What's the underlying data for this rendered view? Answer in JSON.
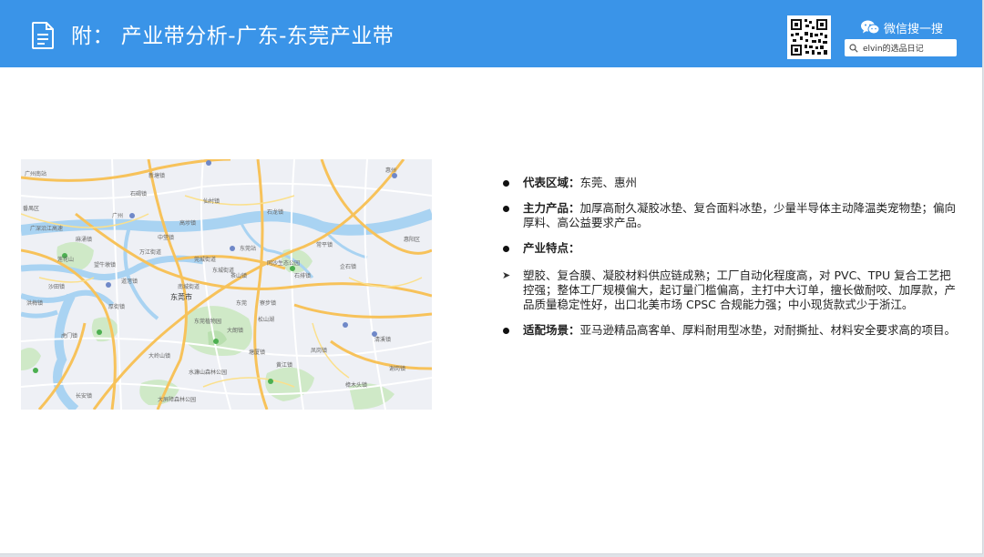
{
  "header": {
    "title": "附：  产业带分析-广东-东莞产业带",
    "wechat_label": "微信搜一搜",
    "search_text": "elvin的选品日记",
    "bg_color": "#3a94e8"
  },
  "map": {
    "center_label": "东莞市",
    "labels": [
      "广州",
      "广深沿江高速",
      "东莞",
      "东莞站",
      "惠州",
      "清溪镇",
      "樟木头镇",
      "石碣镇",
      "石龙镇",
      "茶山镇",
      "麻涌镇",
      "沙田镇",
      "厚街镇",
      "虎门镇",
      "长安镇",
      "大岭山镇",
      "寮步镇",
      "大朗镇",
      "黄江镇",
      "常平镇",
      "凤岗镇",
      "塘厦镇",
      "东莞植物园",
      "广州南站",
      "番禺区",
      "莲花山",
      "石排镇",
      "企石镇",
      "谢岗镇",
      "惠阳区",
      "新塘镇",
      "仙村镇",
      "中堂镇",
      "望牛墩镇",
      "道滘镇",
      "洪梅镇",
      "高埗镇",
      "东城街道",
      "南城街道",
      "万江街道",
      "莞城街道",
      "松山湖",
      "同沙生态公园",
      "水濂山森林公园",
      "大屏障森林公园"
    ]
  },
  "content": {
    "items": [
      {
        "label": "代表区域：",
        "text": "东莞、惠州"
      },
      {
        "label": "主力产品：",
        "text": "加厚高耐久凝胶冰垫、复合面料冰垫，少量半导体主动降温类宠物垫；偏向厚料、高公益要求产品。"
      },
      {
        "label": "产业特点：",
        "text": ""
      },
      {
        "label": "",
        "text": "塑胶、复合膜、凝胶材料供应链成熟；工厂自动化程度高，对 PVC、TPU 复合工艺把控强；整体工厂规模偏大，起订量门槛偏高，主打中大订单，擅长做耐咬、加厚款，产品质量稳定性好，出口北美市场 CPSC 合规能力强；中小现货款式少于浙江。"
      },
      {
        "label": "适配场景：",
        "text": "亚马逊精品高客单、厚料耐用型冰垫，对耐撕扯、材料安全要求高的项目。"
      }
    ]
  }
}
